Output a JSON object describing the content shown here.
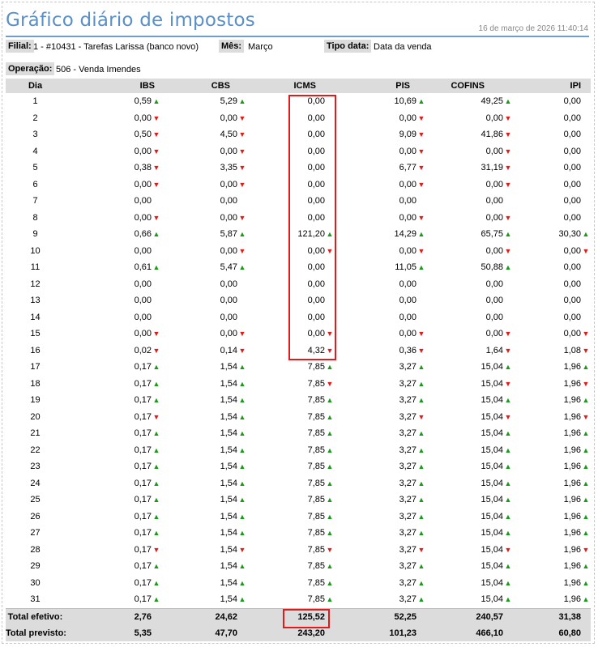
{
  "report": {
    "title": "Gráfico diário de impostos",
    "timestamp": "16 de março de 2026 11:40:14"
  },
  "filters": {
    "filial_label": "Filial:",
    "filial_value": "1 - #10431 - Tarefas Larissa (banco novo)",
    "mes_label": "Mês:",
    "mes_value": "Março",
    "tipo_label": "Tipo data:",
    "tipo_value": "Data da venda",
    "operacao_label": "Operação:",
    "operacao_value": "506 - Venda Imendes"
  },
  "table": {
    "headers": [
      "Dia",
      "IBS",
      "CBS",
      "ICMS",
      "PIS",
      "COFINS",
      "IPI"
    ],
    "rows": [
      {
        "dia": "1",
        "cells": [
          [
            "0,59",
            "up"
          ],
          [
            "5,29",
            "up"
          ],
          [
            "0,00",
            ""
          ],
          [
            "10,69",
            "up"
          ],
          [
            "49,25",
            "up"
          ],
          [
            "0,00",
            ""
          ]
        ]
      },
      {
        "dia": "2",
        "cells": [
          [
            "0,00",
            "down"
          ],
          [
            "0,00",
            "down"
          ],
          [
            "0,00",
            ""
          ],
          [
            "0,00",
            "down"
          ],
          [
            "0,00",
            "down"
          ],
          [
            "0,00",
            ""
          ]
        ]
      },
      {
        "dia": "3",
        "cells": [
          [
            "0,50",
            "down"
          ],
          [
            "4,50",
            "down"
          ],
          [
            "0,00",
            ""
          ],
          [
            "9,09",
            "down"
          ],
          [
            "41,86",
            "down"
          ],
          [
            "0,00",
            ""
          ]
        ]
      },
      {
        "dia": "4",
        "cells": [
          [
            "0,00",
            "down"
          ],
          [
            "0,00",
            "down"
          ],
          [
            "0,00",
            ""
          ],
          [
            "0,00",
            "down"
          ],
          [
            "0,00",
            "down"
          ],
          [
            "0,00",
            ""
          ]
        ]
      },
      {
        "dia": "5",
        "cells": [
          [
            "0,38",
            "down"
          ],
          [
            "3,35",
            "down"
          ],
          [
            "0,00",
            ""
          ],
          [
            "6,77",
            "down"
          ],
          [
            "31,19",
            "down"
          ],
          [
            "0,00",
            ""
          ]
        ]
      },
      {
        "dia": "6",
        "cells": [
          [
            "0,00",
            "down"
          ],
          [
            "0,00",
            "down"
          ],
          [
            "0,00",
            ""
          ],
          [
            "0,00",
            "down"
          ],
          [
            "0,00",
            "down"
          ],
          [
            "0,00",
            ""
          ]
        ]
      },
      {
        "dia": "7",
        "cells": [
          [
            "0,00",
            ""
          ],
          [
            "0,00",
            ""
          ],
          [
            "0,00",
            ""
          ],
          [
            "0,00",
            ""
          ],
          [
            "0,00",
            ""
          ],
          [
            "0,00",
            ""
          ]
        ]
      },
      {
        "dia": "8",
        "cells": [
          [
            "0,00",
            "down"
          ],
          [
            "0,00",
            "down"
          ],
          [
            "0,00",
            ""
          ],
          [
            "0,00",
            "down"
          ],
          [
            "0,00",
            "down"
          ],
          [
            "0,00",
            ""
          ]
        ]
      },
      {
        "dia": "9",
        "cells": [
          [
            "0,66",
            "up"
          ],
          [
            "5,87",
            "up"
          ],
          [
            "121,20",
            "up"
          ],
          [
            "14,29",
            "up"
          ],
          [
            "65,75",
            "up"
          ],
          [
            "30,30",
            "up"
          ]
        ]
      },
      {
        "dia": "10",
        "cells": [
          [
            "0,00",
            ""
          ],
          [
            "0,00",
            "down"
          ],
          [
            "0,00",
            "down"
          ],
          [
            "0,00",
            "down"
          ],
          [
            "0,00",
            "down"
          ],
          [
            "0,00",
            "down"
          ]
        ]
      },
      {
        "dia": "11",
        "cells": [
          [
            "0,61",
            "up"
          ],
          [
            "5,47",
            "up"
          ],
          [
            "0,00",
            ""
          ],
          [
            "11,05",
            "up"
          ],
          [
            "50,88",
            "up"
          ],
          [
            "0,00",
            ""
          ]
        ]
      },
      {
        "dia": "12",
        "cells": [
          [
            "0,00",
            ""
          ],
          [
            "0,00",
            ""
          ],
          [
            "0,00",
            ""
          ],
          [
            "0,00",
            ""
          ],
          [
            "0,00",
            ""
          ],
          [
            "0,00",
            ""
          ]
        ]
      },
      {
        "dia": "13",
        "cells": [
          [
            "0,00",
            ""
          ],
          [
            "0,00",
            ""
          ],
          [
            "0,00",
            ""
          ],
          [
            "0,00",
            ""
          ],
          [
            "0,00",
            ""
          ],
          [
            "0,00",
            ""
          ]
        ]
      },
      {
        "dia": "14",
        "cells": [
          [
            "0,00",
            ""
          ],
          [
            "0,00",
            ""
          ],
          [
            "0,00",
            ""
          ],
          [
            "0,00",
            ""
          ],
          [
            "0,00",
            ""
          ],
          [
            "0,00",
            ""
          ]
        ]
      },
      {
        "dia": "15",
        "cells": [
          [
            "0,00",
            "down"
          ],
          [
            "0,00",
            "down"
          ],
          [
            "0,00",
            "down"
          ],
          [
            "0,00",
            "down"
          ],
          [
            "0,00",
            "down"
          ],
          [
            "0,00",
            "down"
          ]
        ]
      },
      {
        "dia": "16",
        "cells": [
          [
            "0,02",
            "down"
          ],
          [
            "0,14",
            "down"
          ],
          [
            "4,32",
            "down"
          ],
          [
            "0,36",
            "down"
          ],
          [
            "1,64",
            "down"
          ],
          [
            "1,08",
            "down"
          ]
        ]
      },
      {
        "dia": "17",
        "cells": [
          [
            "0,17",
            "up"
          ],
          [
            "1,54",
            "up"
          ],
          [
            "7,85",
            "up"
          ],
          [
            "3,27",
            "up"
          ],
          [
            "15,04",
            "up"
          ],
          [
            "1,96",
            "up"
          ]
        ]
      },
      {
        "dia": "18",
        "cells": [
          [
            "0,17",
            "up"
          ],
          [
            "1,54",
            "up"
          ],
          [
            "7,85",
            "down"
          ],
          [
            "3,27",
            "up"
          ],
          [
            "15,04",
            "down"
          ],
          [
            "1,96",
            "down"
          ]
        ]
      },
      {
        "dia": "19",
        "cells": [
          [
            "0,17",
            "up"
          ],
          [
            "1,54",
            "up"
          ],
          [
            "7,85",
            "up"
          ],
          [
            "3,27",
            "up"
          ],
          [
            "15,04",
            "up"
          ],
          [
            "1,96",
            "up"
          ]
        ]
      },
      {
        "dia": "20",
        "cells": [
          [
            "0,17",
            "down"
          ],
          [
            "1,54",
            "up"
          ],
          [
            "7,85",
            "up"
          ],
          [
            "3,27",
            "down"
          ],
          [
            "15,04",
            "down"
          ],
          [
            "1,96",
            "down"
          ]
        ]
      },
      {
        "dia": "21",
        "cells": [
          [
            "0,17",
            "up"
          ],
          [
            "1,54",
            "up"
          ],
          [
            "7,85",
            "up"
          ],
          [
            "3,27",
            "up"
          ],
          [
            "15,04",
            "up"
          ],
          [
            "1,96",
            "up"
          ]
        ]
      },
      {
        "dia": "22",
        "cells": [
          [
            "0,17",
            "up"
          ],
          [
            "1,54",
            "up"
          ],
          [
            "7,85",
            "up"
          ],
          [
            "3,27",
            "up"
          ],
          [
            "15,04",
            "up"
          ],
          [
            "1,96",
            "up"
          ]
        ]
      },
      {
        "dia": "23",
        "cells": [
          [
            "0,17",
            "up"
          ],
          [
            "1,54",
            "up"
          ],
          [
            "7,85",
            "up"
          ],
          [
            "3,27",
            "up"
          ],
          [
            "15,04",
            "up"
          ],
          [
            "1,96",
            "up"
          ]
        ]
      },
      {
        "dia": "24",
        "cells": [
          [
            "0,17",
            "up"
          ],
          [
            "1,54",
            "up"
          ],
          [
            "7,85",
            "up"
          ],
          [
            "3,27",
            "up"
          ],
          [
            "15,04",
            "up"
          ],
          [
            "1,96",
            "up"
          ]
        ]
      },
      {
        "dia": "25",
        "cells": [
          [
            "0,17",
            "up"
          ],
          [
            "1,54",
            "up"
          ],
          [
            "7,85",
            "up"
          ],
          [
            "3,27",
            "up"
          ],
          [
            "15,04",
            "up"
          ],
          [
            "1,96",
            "up"
          ]
        ]
      },
      {
        "dia": "26",
        "cells": [
          [
            "0,17",
            "up"
          ],
          [
            "1,54",
            "up"
          ],
          [
            "7,85",
            "up"
          ],
          [
            "3,27",
            "up"
          ],
          [
            "15,04",
            "up"
          ],
          [
            "1,96",
            "up"
          ]
        ]
      },
      {
        "dia": "27",
        "cells": [
          [
            "0,17",
            "up"
          ],
          [
            "1,54",
            "up"
          ],
          [
            "7,85",
            "up"
          ],
          [
            "3,27",
            "up"
          ],
          [
            "15,04",
            "up"
          ],
          [
            "1,96",
            "up"
          ]
        ]
      },
      {
        "dia": "28",
        "cells": [
          [
            "0,17",
            "down"
          ],
          [
            "1,54",
            "down"
          ],
          [
            "7,85",
            "down"
          ],
          [
            "3,27",
            "down"
          ],
          [
            "15,04",
            "down"
          ],
          [
            "1,96",
            "down"
          ]
        ]
      },
      {
        "dia": "29",
        "cells": [
          [
            "0,17",
            "up"
          ],
          [
            "1,54",
            "up"
          ],
          [
            "7,85",
            "up"
          ],
          [
            "3,27",
            "up"
          ],
          [
            "15,04",
            "up"
          ],
          [
            "1,96",
            "up"
          ]
        ]
      },
      {
        "dia": "30",
        "cells": [
          [
            "0,17",
            "up"
          ],
          [
            "1,54",
            "up"
          ],
          [
            "7,85",
            "up"
          ],
          [
            "3,27",
            "up"
          ],
          [
            "15,04",
            "up"
          ],
          [
            "1,96",
            "up"
          ]
        ]
      },
      {
        "dia": "31",
        "cells": [
          [
            "0,17",
            "up"
          ],
          [
            "1,54",
            "up"
          ],
          [
            "7,85",
            "up"
          ],
          [
            "3,27",
            "up"
          ],
          [
            "15,04",
            "up"
          ],
          [
            "1,96",
            "up"
          ]
        ]
      }
    ],
    "totals": [
      {
        "label": "Total efetivo:",
        "values": [
          "2,76",
          "24,62",
          "125,52",
          "52,25",
          "240,57",
          "31,38"
        ]
      },
      {
        "label": "Total previsto:",
        "values": [
          "5,35",
          "47,70",
          "243,20",
          "101,23",
          "466,10",
          "60,80"
        ]
      }
    ]
  },
  "colors": {
    "title": "#5b8fc7",
    "header_bg": "#dcdcdc",
    "arrow_up": "#1a9a1a",
    "arrow_down": "#e01b1b",
    "highlight": "#e01b1b"
  }
}
